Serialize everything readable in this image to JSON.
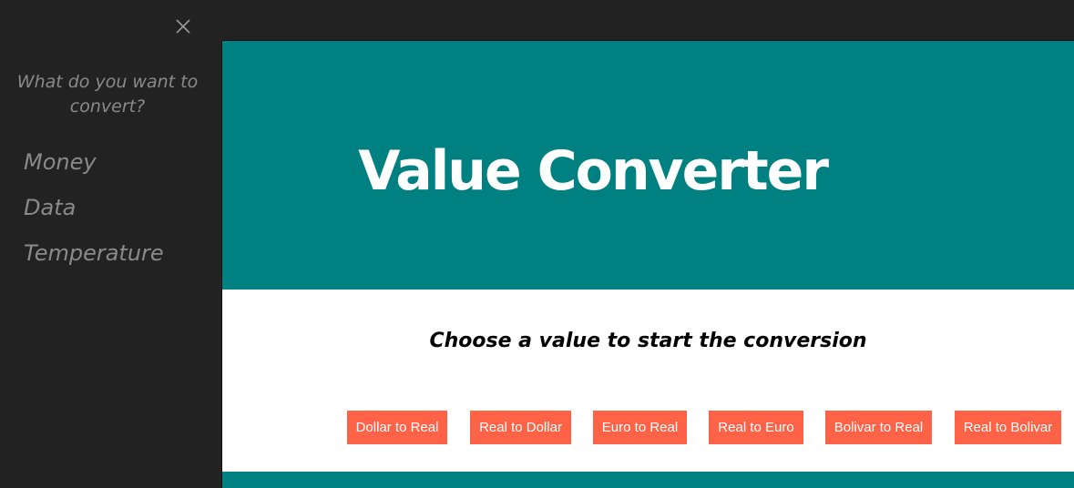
{
  "sidebar": {
    "close_icon": "close-icon",
    "question": "What do you want to convert?",
    "items": [
      {
        "label": "Money"
      },
      {
        "label": "Data"
      },
      {
        "label": "Temperature"
      }
    ]
  },
  "hero": {
    "title": "Value Converter"
  },
  "main": {
    "subtitle": "Choose a value to start the conversion",
    "buttons": [
      {
        "label": "Dollar to Real"
      },
      {
        "label": "Real to Dollar"
      },
      {
        "label": "Euro to Real"
      },
      {
        "label": "Real to Euro"
      },
      {
        "label": "Bolivar to Real"
      },
      {
        "label": "Real to Bolivar"
      }
    ]
  },
  "colors": {
    "sidebar_bg": "#222222",
    "hero_bg": "#008080",
    "button_bg": "#ff6347",
    "sidebar_text": "#8a8a8a"
  }
}
